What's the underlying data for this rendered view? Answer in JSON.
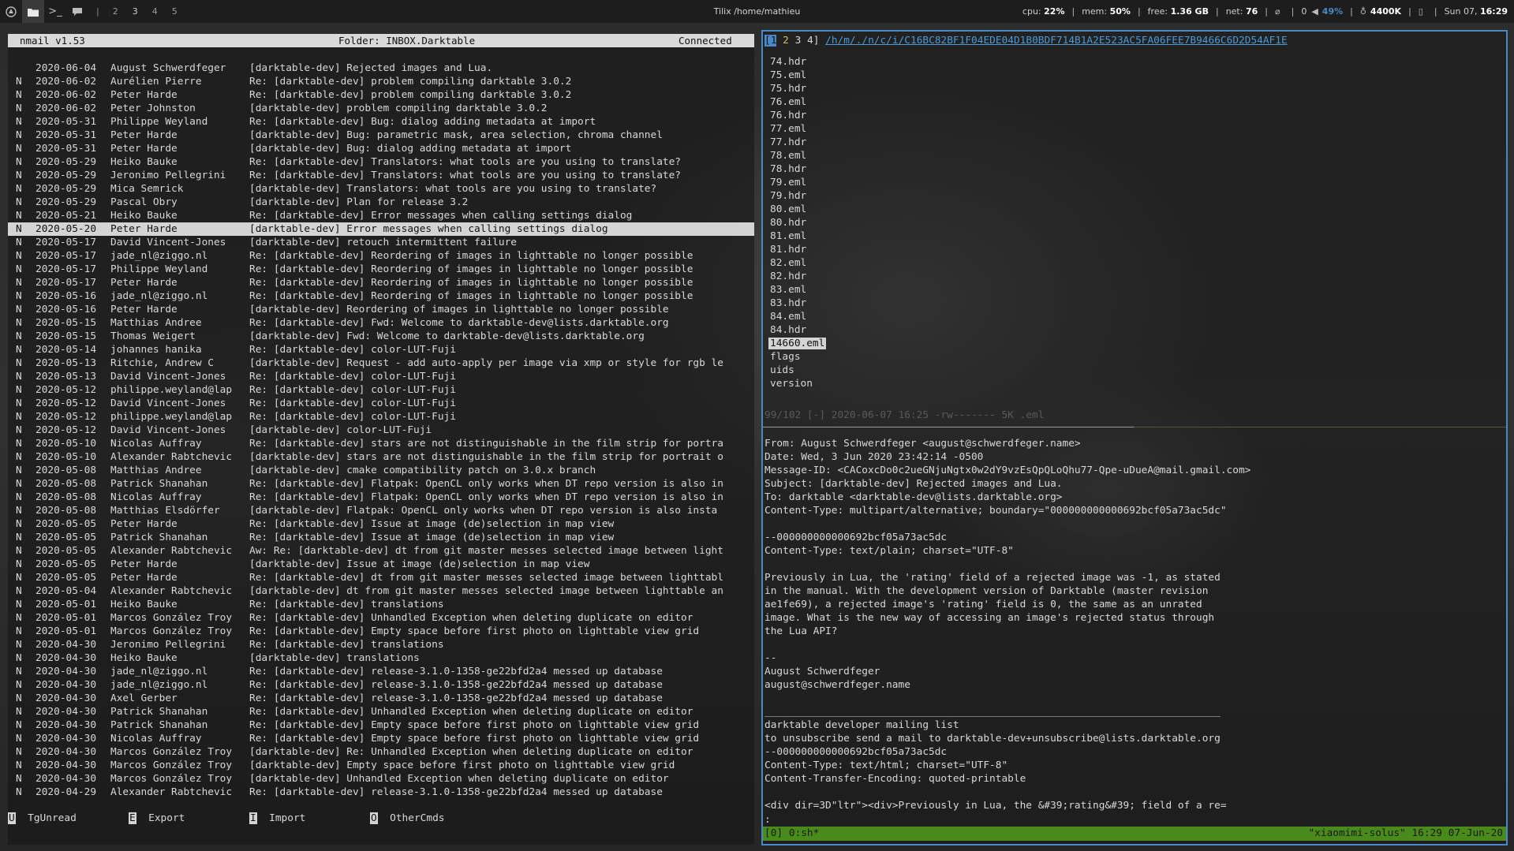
{
  "topbar": {
    "workspaces": [
      "2",
      "3",
      "4",
      "5"
    ],
    "current_workspace": "3",
    "title": "Tilix /home/mathieu",
    "cpu_label": "cpu:",
    "cpu_value": "22%",
    "mem_label": "mem:",
    "mem_value": "50%",
    "free_label": "free:",
    "free_value": "1.36 GB",
    "net_label": "net:",
    "net_value": "76",
    "wifi_value": "0",
    "volume_value": "49%",
    "brightness_value": "4400K",
    "date": "Sun 07,",
    "time": "16:29"
  },
  "nmail": {
    "app": "nmail v1.53",
    "folder": "Folder: INBOX.Darktable",
    "status": "Connected",
    "messages": [
      {
        "flag": "",
        "date": "2020-06-04",
        "from": "August Schwerdfeger",
        "subject": "[darktable-dev] Rejected images and Lua."
      },
      {
        "flag": "N",
        "date": "2020-06-02",
        "from": "Aurélien Pierre",
        "subject": "Re: [darktable-dev] problem compiling darktable 3.0.2"
      },
      {
        "flag": "N",
        "date": "2020-06-02",
        "from": "Peter Harde",
        "subject": "Re: [darktable-dev] problem compiling darktable 3.0.2"
      },
      {
        "flag": "N",
        "date": "2020-06-02",
        "from": "Peter Johnston",
        "subject": "[darktable-dev] problem compiling darktable 3.0.2"
      },
      {
        "flag": "N",
        "date": "2020-05-31",
        "from": "Philippe Weyland",
        "subject": "Re: [darktable-dev] Bug: dialog adding metadata at import"
      },
      {
        "flag": "N",
        "date": "2020-05-31",
        "from": "Peter Harde",
        "subject": "[darktable-dev] Bug: parametric mask, area selection, chroma channel"
      },
      {
        "flag": "N",
        "date": "2020-05-31",
        "from": "Peter Harde",
        "subject": "[darktable-dev] Bug: dialog adding metadata at import"
      },
      {
        "flag": "N",
        "date": "2020-05-29",
        "from": "Heiko Bauke",
        "subject": "Re: [darktable-dev] Translators: what tools are you using to translate?"
      },
      {
        "flag": "N",
        "date": "2020-05-29",
        "from": "Jeronimo Pellegrini",
        "subject": "Re: [darktable-dev] Translators: what tools are you using to translate?"
      },
      {
        "flag": "N",
        "date": "2020-05-29",
        "from": "Mica Semrick",
        "subject": "[darktable-dev] Translators: what tools are you using to translate?"
      },
      {
        "flag": "N",
        "date": "2020-05-29",
        "from": "Pascal Obry",
        "subject": "[darktable-dev] Plan for release 3.2"
      },
      {
        "flag": "N",
        "date": "2020-05-21",
        "from": "Heiko Bauke",
        "subject": "Re: [darktable-dev] Error messages when calling settings dialog"
      },
      {
        "flag": "N",
        "date": "2020-05-20",
        "from": "Peter Harde",
        "subject": "[darktable-dev] Error messages when calling settings dialog",
        "selected": true
      },
      {
        "flag": "N",
        "date": "2020-05-17",
        "from": "David Vincent-Jones",
        "subject": "[darktable-dev] retouch intermittent failure"
      },
      {
        "flag": "N",
        "date": "2020-05-17",
        "from": "jade_nl@ziggo.nl",
        "subject": "Re: [darktable-dev] Reordering of images in lighttable no longer possible"
      },
      {
        "flag": "N",
        "date": "2020-05-17",
        "from": "Philippe Weyland",
        "subject": "Re: [darktable-dev] Reordering of images in lighttable no longer possible"
      },
      {
        "flag": "N",
        "date": "2020-05-17",
        "from": "Peter Harde",
        "subject": "Re: [darktable-dev] Reordering of images in lighttable no longer possible"
      },
      {
        "flag": "N",
        "date": "2020-05-16",
        "from": "jade_nl@ziggo.nl",
        "subject": "Re: [darktable-dev] Reordering of images in lighttable no longer possible"
      },
      {
        "flag": "N",
        "date": "2020-05-16",
        "from": "Peter Harde",
        "subject": "[darktable-dev] Reordering of images in lighttable no longer possible"
      },
      {
        "flag": "N",
        "date": "2020-05-15",
        "from": "Matthias Andree",
        "subject": "Re: [darktable-dev] Fwd: Welcome to darktable-dev@lists.darktable.org"
      },
      {
        "flag": "N",
        "date": "2020-05-15",
        "from": "Thomas Weigert",
        "subject": "[darktable-dev] Fwd: Welcome to darktable-dev@lists.darktable.org"
      },
      {
        "flag": "N",
        "date": "2020-05-14",
        "from": "johannes hanika",
        "subject": "Re: [darktable-dev] color-LUT-Fuji"
      },
      {
        "flag": "N",
        "date": "2020-05-13",
        "from": "Ritchie, Andrew C",
        "subject": "[darktable-dev] Request - add auto-apply per image via xmp or style for rgb le"
      },
      {
        "flag": "N",
        "date": "2020-05-13",
        "from": "David Vincent-Jones",
        "subject": "Re: [darktable-dev] color-LUT-Fuji"
      },
      {
        "flag": "N",
        "date": "2020-05-12",
        "from": "philippe.weyland@lap",
        "subject": "Re: [darktable-dev] color-LUT-Fuji"
      },
      {
        "flag": "N",
        "date": "2020-05-12",
        "from": "David Vincent-Jones",
        "subject": "Re: [darktable-dev] color-LUT-Fuji"
      },
      {
        "flag": "N",
        "date": "2020-05-12",
        "from": "philippe.weyland@lap",
        "subject": "Re: [darktable-dev] color-LUT-Fuji"
      },
      {
        "flag": "N",
        "date": "2020-05-12",
        "from": "David Vincent-Jones",
        "subject": "[darktable-dev] color-LUT-Fuji"
      },
      {
        "flag": "N",
        "date": "2020-05-10",
        "from": "Nicolas Auffray",
        "subject": "Re: [darktable-dev] stars are not distinguishable in the film strip for portra"
      },
      {
        "flag": "N",
        "date": "2020-05-10",
        "from": "Alexander Rabtchevic",
        "subject": "[darktable-dev] stars are not distinguishable in the film strip for portrait o"
      },
      {
        "flag": "N",
        "date": "2020-05-08",
        "from": "Matthias Andree",
        "subject": "[darktable-dev] cmake compatibility patch on 3.0.x branch"
      },
      {
        "flag": "N",
        "date": "2020-05-08",
        "from": "Patrick Shanahan",
        "subject": "Re: [darktable-dev] Flatpak: OpenCL only works when DT repo version is also in"
      },
      {
        "flag": "N",
        "date": "2020-05-08",
        "from": "Nicolas Auffray",
        "subject": "Re: [darktable-dev] Flatpak: OpenCL only works when DT repo version is also in"
      },
      {
        "flag": "N",
        "date": "2020-05-08",
        "from": "Matthias Elsdörfer",
        "subject": "[darktable-dev] Flatpak: OpenCL only works when DT repo version is also insta"
      },
      {
        "flag": "N",
        "date": "2020-05-05",
        "from": "Peter Harde",
        "subject": "Re: [darktable-dev] Issue at image (de)selection in map view"
      },
      {
        "flag": "N",
        "date": "2020-05-05",
        "from": "Patrick Shanahan",
        "subject": "Re: [darktable-dev] Issue at image (de)selection in map view"
      },
      {
        "flag": "N",
        "date": "2020-05-05",
        "from": "Alexander Rabtchevic",
        "subject": "Aw: Re: [darktable-dev] dt from git master messes selected image between light"
      },
      {
        "flag": "N",
        "date": "2020-05-05",
        "from": "Peter Harde",
        "subject": "[darktable-dev] Issue at image (de)selection in map view"
      },
      {
        "flag": "N",
        "date": "2020-05-05",
        "from": "Peter Harde",
        "subject": "Re: [darktable-dev] dt from git master messes selected image between lighttabl"
      },
      {
        "flag": "N",
        "date": "2020-05-04",
        "from": "Alexander Rabtchevic",
        "subject": "[darktable-dev] dt from git master messes selected image between lighttable an"
      },
      {
        "flag": "N",
        "date": "2020-05-01",
        "from": "Heiko Bauke",
        "subject": "Re: [darktable-dev] translations"
      },
      {
        "flag": "N",
        "date": "2020-05-01",
        "from": "Marcos González Troy",
        "subject": "Re: [darktable-dev] Unhandled Exception when deleting duplicate on editor"
      },
      {
        "flag": "N",
        "date": "2020-05-01",
        "from": "Marcos González Troy",
        "subject": "Re: [darktable-dev] Empty space before first photo on lighttable view grid"
      },
      {
        "flag": "N",
        "date": "2020-04-30",
        "from": "Jeronimo Pellegrini",
        "subject": "Re: [darktable-dev] translations"
      },
      {
        "flag": "N",
        "date": "2020-04-30",
        "from": "Heiko Bauke",
        "subject": "[darktable-dev] translations"
      },
      {
        "flag": "N",
        "date": "2020-04-30",
        "from": "jade_nl@ziggo.nl",
        "subject": "Re: [darktable-dev] release-3.1.0-1358-ge22bfd2a4 messed up database"
      },
      {
        "flag": "N",
        "date": "2020-04-30",
        "from": "jade_nl@ziggo.nl",
        "subject": "Re: [darktable-dev] release-3.1.0-1358-ge22bfd2a4 messed up database"
      },
      {
        "flag": "N",
        "date": "2020-04-30",
        "from": "Axel Gerber",
        "subject": "Re: [darktable-dev] release-3.1.0-1358-ge22bfd2a4 messed up database"
      },
      {
        "flag": "N",
        "date": "2020-04-30",
        "from": "Patrick Shanahan",
        "subject": "Re: [darktable-dev] Unhandled Exception when deleting duplicate on editor"
      },
      {
        "flag": "N",
        "date": "2020-04-30",
        "from": "Patrick Shanahan",
        "subject": "Re: [darktable-dev] Empty space before first photo on lighttable view grid"
      },
      {
        "flag": "N",
        "date": "2020-04-30",
        "from": "Nicolas Auffray",
        "subject": "Re: [darktable-dev] Empty space before first photo on lighttable view grid"
      },
      {
        "flag": "N",
        "date": "2020-04-30",
        "from": "Marcos González Troy",
        "subject": "[darktable-dev] Re: Unhandled Exception when deleting duplicate on editor"
      },
      {
        "flag": "N",
        "date": "2020-04-30",
        "from": "Marcos González Troy",
        "subject": "[darktable-dev] Empty space before first photo on lighttable view grid"
      },
      {
        "flag": "N",
        "date": "2020-04-30",
        "from": "Marcos González Troy",
        "subject": "[darktable-dev] Unhandled Exception when deleting duplicate on editor"
      },
      {
        "flag": "N",
        "date": "2020-04-29",
        "from": "Alexander Rabtchevic",
        "subject": "Re: [darktable-dev] release-3.1.0-1358-ge22bfd2a4 messed up database"
      }
    ],
    "footer": [
      {
        "key": "U",
        "label": "TgUnread"
      },
      {
        "key": "E",
        "label": "Export"
      },
      {
        "key": "I",
        "label": "Import"
      },
      {
        "key": "O",
        "label": "OtherCmds"
      }
    ]
  },
  "terminal": {
    "tab_open": "[",
    "tab_active": "1",
    "tab_second": "2",
    "tab_rest": "3 4]",
    "path": "/h/m/./n/c/i/C16BC82BF1F04EDE04D1B0BDF714B1A2E523AC5FA06FEE7B9466C6D2D54AF1E",
    "files": [
      "74.hdr",
      "75.eml",
      "75.hdr",
      "76.eml",
      "76.hdr",
      "77.eml",
      "77.hdr",
      "78.eml",
      "78.hdr",
      "79.eml",
      "79.hdr",
      "80.eml",
      "80.hdr",
      "81.eml",
      "81.hdr",
      "82.eml",
      "82.hdr",
      "83.eml",
      "83.hdr",
      "84.eml",
      "84.hdr",
      "14660.eml",
      "flags",
      "uids",
      "version"
    ],
    "selected_file": "14660.eml",
    "lf_status": "99/102 [-] 2020-06-07 16:25 -rw------- 5K .eml",
    "mail_lines": [
      "From: August Schwerdfeger <august@schwerdfeger.name>",
      "Date: Wed, 3 Jun 2020 23:42:14 -0500",
      "Message-ID: <CACoxcDo0c2ueGNjuNgtx0w2dY9vzEsQpQLoQhu77-Qpe-uDueA@mail.gmail.com>",
      "Subject: [darktable-dev] Rejected images and Lua.",
      "To: darktable <darktable-dev@lists.darktable.org>",
      "Content-Type: multipart/alternative; boundary=\"000000000000692bcf05a73ac5dc\"",
      "",
      "--000000000000692bcf05a73ac5dc",
      "Content-Type: text/plain; charset=\"UTF-8\"",
      "",
      "Previously in Lua, the 'rating' field of a rejected image was -1, as stated",
      "in the manual. With the development version of Darktable (master revision",
      "ae1fe69), a rejected image's 'rating' field is 0, the same as an unrated",
      "image. What is the new way of accessing an image's rejected status through",
      "the Lua API?",
      "",
      "--",
      "August Schwerdfeger",
      "august@schwerdfeger.name",
      "",
      "___________________________________________________________________________",
      "darktable developer mailing list",
      "to unsubscribe send a mail to darktable-dev+unsubscribe@lists.darktable.org",
      "--000000000000692bcf05a73ac5dc",
      "Content-Type: text/html; charset=\"UTF-8\"",
      "Content-Transfer-Encoding: quoted-printable",
      "",
      "<div dir=3D\"ltr\"><div>Previously in Lua, the &#39;rating&#39; field of a re="
    ],
    "prompt": ":",
    "tmux_left": "[0] 0:sh*",
    "tmux_right": "\"xiaomimi-solus\" 16:29 07-Jun-20"
  }
}
